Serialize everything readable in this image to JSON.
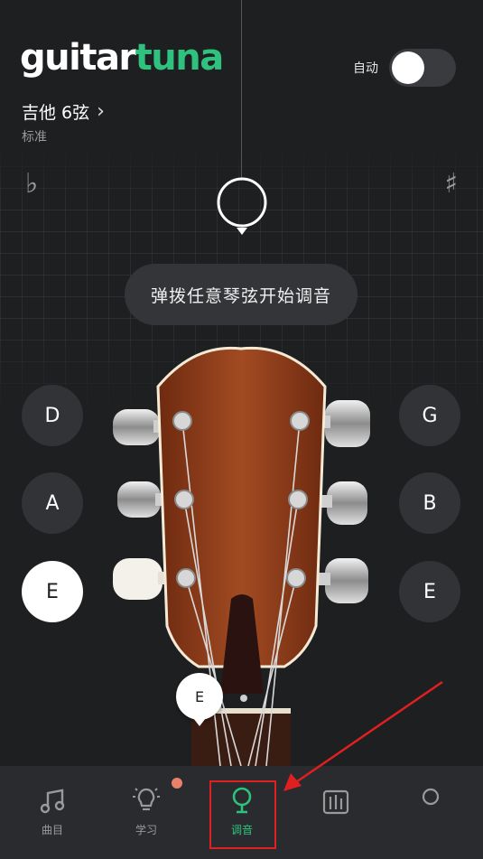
{
  "logo": {
    "part1": "guitar",
    "part2": "tuna"
  },
  "header": {
    "auto_label": "自动",
    "auto_enabled": false
  },
  "instrument": {
    "name": "吉他 6弦",
    "chevron": "›",
    "tuning": "标准"
  },
  "meter": {
    "flat_symbol": "♭",
    "sharp_symbol": "♯"
  },
  "hint": "弹拨任意琴弦开始调音",
  "strings": {
    "left": [
      {
        "note": "D"
      },
      {
        "note": "A"
      },
      {
        "note": "E",
        "active": true
      }
    ],
    "right": [
      {
        "note": "G"
      },
      {
        "note": "B"
      },
      {
        "note": "E"
      }
    ]
  },
  "detected_note": "E",
  "tabbar": {
    "items": [
      {
        "label": "曲目",
        "icon": "music-note-icon"
      },
      {
        "label": "学习",
        "icon": "lightbulb-icon",
        "badge": true
      },
      {
        "label": "调音",
        "icon": "tuner-pin-icon",
        "active": true
      },
      {
        "label": "",
        "icon": "metronome-icon"
      },
      {
        "label": "",
        "icon": "circle-icon"
      }
    ]
  },
  "colors": {
    "accent": "#2ec27e",
    "background": "#1e1f21",
    "badge": "#e8806a",
    "annotation": "#e02020"
  }
}
